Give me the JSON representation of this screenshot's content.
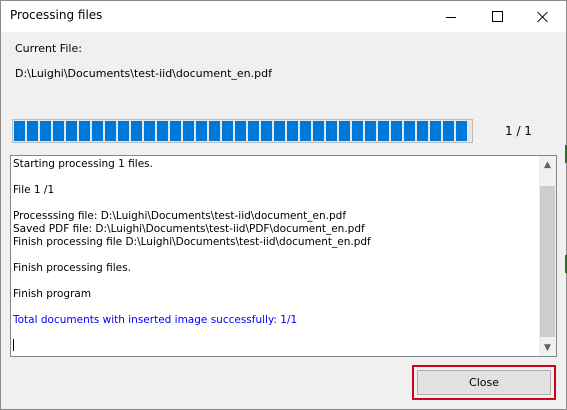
{
  "window": {
    "title": "Processing files"
  },
  "current_file": {
    "label": "Current File:",
    "path": "D:\\Luighi\\Documents\\test-iid\\document_en.pdf"
  },
  "progress": {
    "percent": 100,
    "count_text": "1  /  1"
  },
  "log": {
    "lines": [
      {
        "text": "Starting processing 1 files.",
        "color": "black"
      },
      {
        "text": "",
        "color": "black"
      },
      {
        "text": "File 1 /1",
        "color": "black"
      },
      {
        "text": "",
        "color": "black"
      },
      {
        "text": "Processsing file: D:\\Luighi\\Documents\\test-iid\\document_en.pdf",
        "color": "black"
      },
      {
        "text": "Saved PDF file: D:\\Luighi\\Documents\\test-iid\\PDF\\document_en.pdf",
        "color": "black"
      },
      {
        "text": "Finish processing file D:\\Luighi\\Documents\\test-iid\\document_en.pdf",
        "color": "black"
      },
      {
        "text": "",
        "color": "black"
      },
      {
        "text": "Finish processing files.",
        "color": "black"
      },
      {
        "text": "",
        "color": "black"
      },
      {
        "text": "Finish program",
        "color": "black"
      },
      {
        "text": "",
        "color": "black"
      },
      {
        "text": "Total documents with inserted image successfully: 1/1",
        "color": "blue"
      }
    ]
  },
  "buttons": {
    "close_label": "Close"
  },
  "colors": {
    "accent": "#0078d7",
    "highlight": "#d0021b",
    "link_blue": "#0000ff"
  },
  "icons": [
    "minimize-icon",
    "maximize-icon",
    "close-icon",
    "scroll-up-arrow-icon",
    "scroll-down-arrow-icon"
  ]
}
